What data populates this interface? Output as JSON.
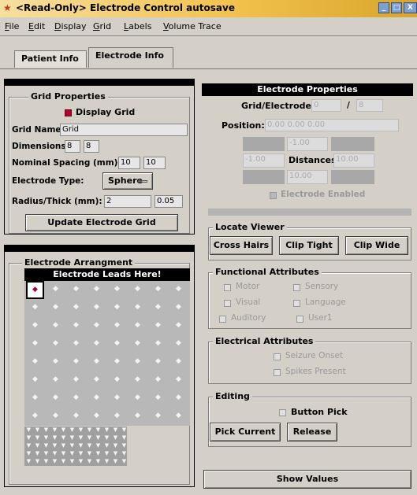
{
  "window": {
    "title": "<Read-Only> Electrode Control autosave",
    "title_visible": "<Read-Only> Electrode Control autosave",
    "controls": [
      "minimize-icon",
      "maximize-icon",
      "close-icon"
    ]
  },
  "menubar": {
    "items": [
      {
        "label": "File",
        "underline": "F"
      },
      {
        "label": "Edit",
        "underline": "E"
      },
      {
        "label": "Display",
        "underline": "D"
      },
      {
        "label": "Grid",
        "underline": "G"
      },
      {
        "label": "Labels",
        "underline": "L"
      },
      {
        "label": "Volume Trace",
        "underline": "V"
      }
    ]
  },
  "tabs": [
    {
      "label": "Patient Info",
      "active": false
    },
    {
      "label": "Electrode Info",
      "active": true
    }
  ],
  "grid_properties": {
    "title": "Grid Properties",
    "display_grid_label": "Display Grid",
    "display_grid_checked": true,
    "grid_name_label": "Grid Name:",
    "grid_name_value": "Grid",
    "dimensions_label": "Dimensions:",
    "dim_x": "8",
    "dim_y": "8",
    "spacing_label": "Nominal Spacing (mm):",
    "spacing_x": "10",
    "spacing_y": "10",
    "electrode_type_label": "Electrode Type:",
    "electrode_type_value": "Sphere",
    "radius_label": "Radius/Thick (mm):",
    "radius_value": "2",
    "thick_value": "0.05",
    "update_button": "Update Electrode Grid"
  },
  "arrangement": {
    "title": "Electrode Arrangment",
    "header": "Electrode Leads Here!",
    "rows": 8,
    "cols": 8,
    "selected_index": 0,
    "selected_color": "#b0003a"
  },
  "electrode_properties": {
    "title": "Electrode Properties",
    "grid_electrode_label": "Grid/Electrode:",
    "grid_value": "0",
    "separator": "/",
    "electrode_value": "8",
    "position_label": "Position:",
    "position_value": "0.00 0.00 0.00",
    "dist_top": "-1.00",
    "dist_left": "-1.00",
    "distances_label": "Distances",
    "dist_right": "10.00",
    "dist_bottom": "10.00",
    "enabled_label": "Electrode Enabled",
    "enabled_checked": true
  },
  "locate_viewer": {
    "title": "Locate Viewer",
    "buttons": [
      "Cross Hairs",
      "Clip Tight",
      "Clip Wide"
    ]
  },
  "functional": {
    "title": "Functional Attributes",
    "items": [
      "Motor",
      "Sensory",
      "Visual",
      "Language",
      "Auditory",
      "User1"
    ]
  },
  "electrical": {
    "title": "Electrical Attributes",
    "items": [
      "Seizure Onset",
      "Spikes Present"
    ]
  },
  "editing": {
    "title": "Editing",
    "button_pick_label": "Button Pick",
    "pick_current": "Pick Current",
    "release": "Release"
  },
  "show_values": "Show Values",
  "colors": {
    "title_gradient_start": "#f6dfa0",
    "title_gradient_end": "#d9a52a",
    "window_bg": "#d4d0c8",
    "checked_red": "#b0003a"
  }
}
